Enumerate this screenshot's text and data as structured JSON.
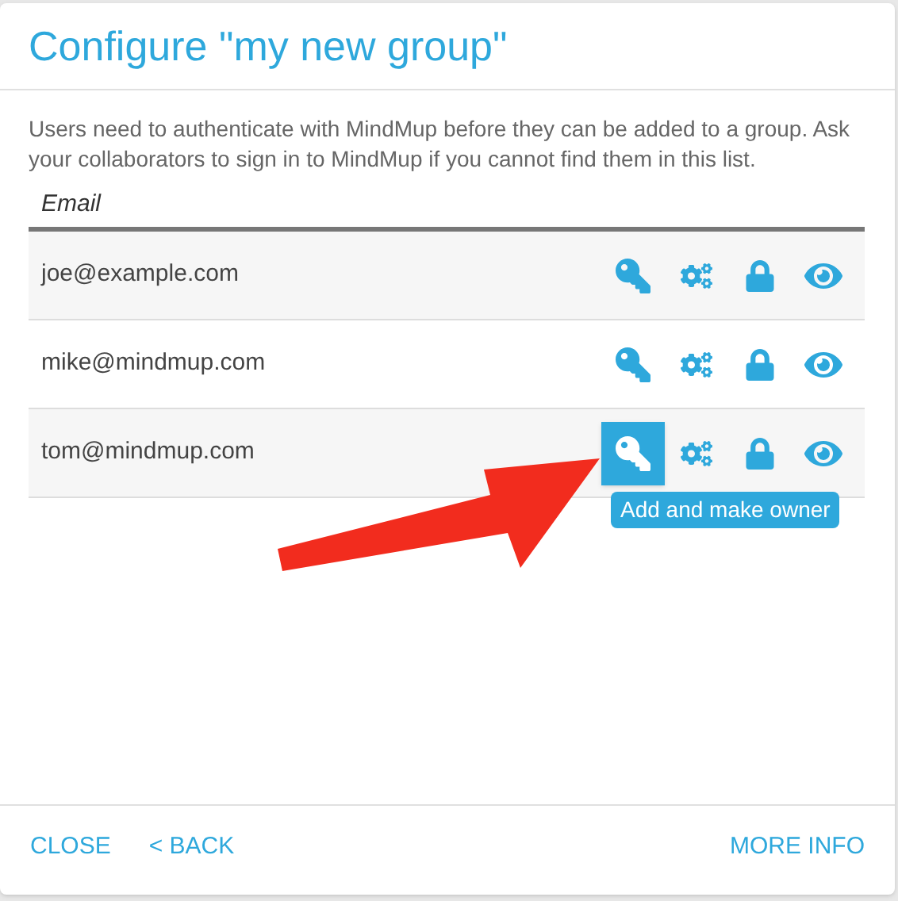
{
  "dialog": {
    "title": "Configure \"my new group\"",
    "description": "Users need to authenticate with MindMup before they can be added to a group. Ask your collaborators to sign in to MindMup if you cannot find them in this list."
  },
  "table": {
    "columns": [
      "Email"
    ],
    "rows": [
      {
        "email": "joe@example.com",
        "actions": [
          {
            "kind": "key",
            "hovered": false
          },
          {
            "kind": "gears",
            "hovered": false
          },
          {
            "kind": "lock",
            "hovered": false
          },
          {
            "kind": "eye",
            "hovered": false
          }
        ]
      },
      {
        "email": "mike@mindmup.com",
        "actions": [
          {
            "kind": "key",
            "hovered": false
          },
          {
            "kind": "gears",
            "hovered": false
          },
          {
            "kind": "lock",
            "hovered": false
          },
          {
            "kind": "eye",
            "hovered": false
          }
        ]
      },
      {
        "email": "tom@mindmup.com",
        "actions": [
          {
            "kind": "key",
            "hovered": true,
            "tooltip": "Add and make owner"
          },
          {
            "kind": "gears",
            "hovered": false
          },
          {
            "kind": "lock",
            "hovered": false
          },
          {
            "kind": "eye",
            "hovered": false
          }
        ]
      }
    ]
  },
  "footer": {
    "left_buttons": [
      "CLOSE",
      "< BACK"
    ],
    "right_button": "MORE INFO"
  }
}
